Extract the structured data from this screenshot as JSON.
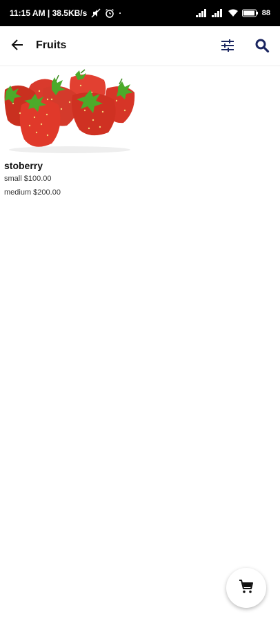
{
  "status_bar": {
    "time_speed": "11:15 AM | 38.5KB/s",
    "dot": "·",
    "battery": "88"
  },
  "app_bar": {
    "title": "Fruits",
    "icons": {
      "back": "arrow-back-icon",
      "filter": "tune-icon",
      "search": "search-icon"
    },
    "accent_color": "#1a2560"
  },
  "products": [
    {
      "name": "stoberry",
      "variants": [
        "small $100.00",
        "medium $200.00"
      ]
    }
  ],
  "fab": {
    "icon": "shopping-cart-icon"
  }
}
